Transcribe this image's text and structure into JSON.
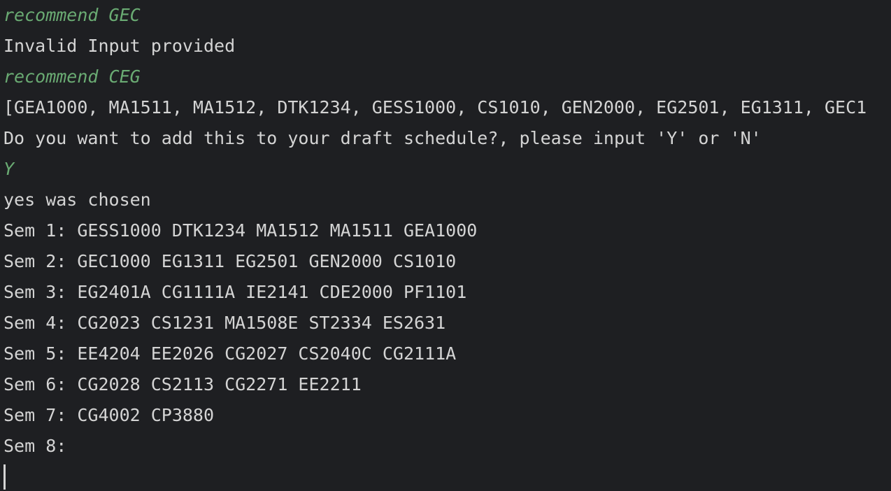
{
  "terminal": {
    "lines": [
      {
        "text": "recommend GEC",
        "kind": "input"
      },
      {
        "text": "Invalid Input provided",
        "kind": "output"
      },
      {
        "text": "recommend CEG",
        "kind": "input"
      },
      {
        "text": "[GEA1000, MA1511, MA1512, DTK1234, GESS1000, CS1010, GEN2000, EG2501, EG1311, GEC1",
        "kind": "output"
      },
      {
        "text": "Do you want to add this to your draft schedule?, please input 'Y' or 'N'",
        "kind": "output"
      },
      {
        "text": "Y",
        "kind": "input"
      },
      {
        "text": "yes was chosen",
        "kind": "output"
      },
      {
        "text": "Sem 1: GESS1000 DTK1234 MA1512 MA1511 GEA1000",
        "kind": "output"
      },
      {
        "text": "Sem 2: GEC1000 EG1311 EG2501 GEN2000 CS1010",
        "kind": "output"
      },
      {
        "text": "Sem 3: EG2401A CG1111A IE2141 CDE2000 PF1101",
        "kind": "output"
      },
      {
        "text": "Sem 4: CG2023 CS1231 MA1508E ST2334 ES2631",
        "kind": "output"
      },
      {
        "text": "Sem 5: EE4204 EE2026 CG2027 CS2040C CG2111A",
        "kind": "output"
      },
      {
        "text": "Sem 6: CG2028 CS2113 CG2271 EE2211",
        "kind": "output"
      },
      {
        "text": "Sem 7: CG4002 CP3880",
        "kind": "output"
      },
      {
        "text": "Sem 8:",
        "kind": "output"
      }
    ]
  },
  "colors": {
    "background": "#1e1f22",
    "output_text": "#d4d4d4",
    "input_text": "#6aab73"
  }
}
